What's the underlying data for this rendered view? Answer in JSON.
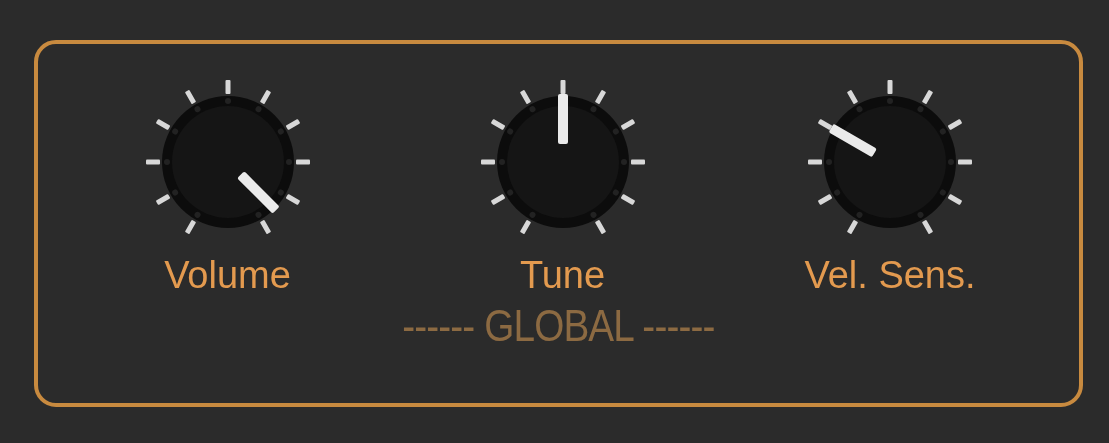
{
  "panel": {
    "title": "------ GLOBAL ------",
    "knobs": [
      {
        "label": "Volume",
        "level": 0.95
      },
      {
        "label": "Tune",
        "level": 0.5
      },
      {
        "label": "Vel. Sens.",
        "level": 0.3
      }
    ]
  }
}
